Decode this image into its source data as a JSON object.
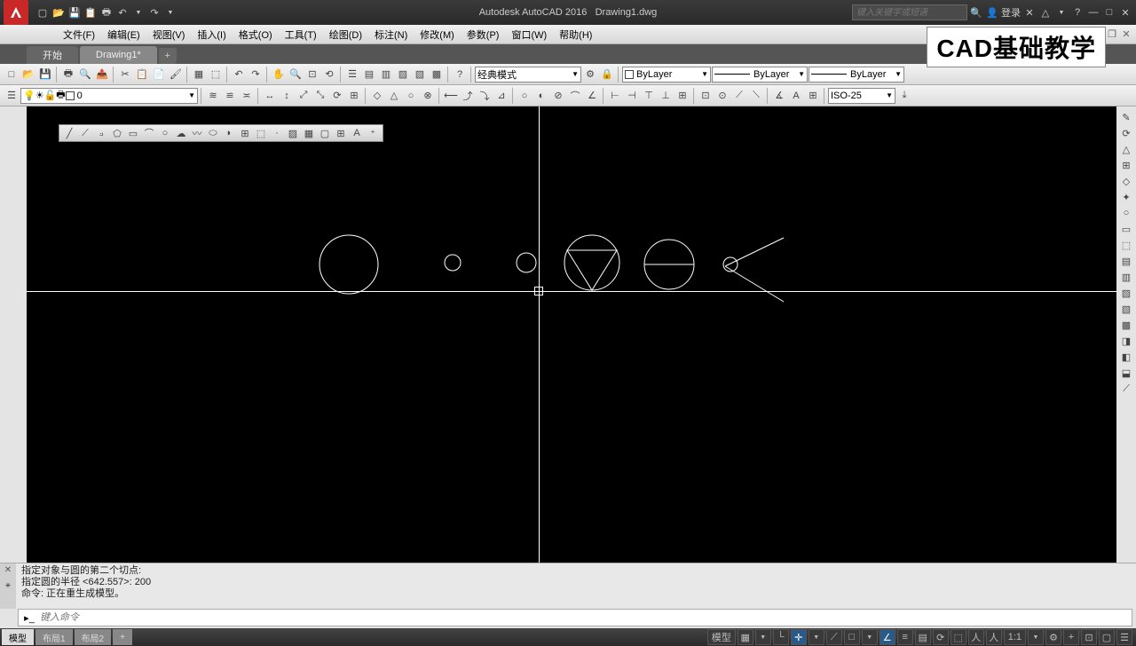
{
  "title": {
    "app": "Autodesk AutoCAD 2016",
    "doc": "Drawing1.dwg"
  },
  "search": {
    "placeholder": "键入关键字或短语",
    "login": "登录"
  },
  "watermark": "CAD基础教学",
  "menus": [
    "文件(F)",
    "编辑(E)",
    "视图(V)",
    "插入(I)",
    "格式(O)",
    "工具(T)",
    "绘图(D)",
    "标注(N)",
    "修改(M)",
    "参数(P)",
    "窗口(W)",
    "帮助(H)"
  ],
  "file_tabs": {
    "start": "开始",
    "draw": "Drawing1*"
  },
  "toolbar1": {
    "workspace": "经典模式"
  },
  "layers": {
    "current": "0",
    "color_label": "ByLayer",
    "linetype": "ByLayer",
    "lineweight": "ByLayer"
  },
  "dimstyle": "ISO-25",
  "cmdline": {
    "l1": "指定对象与圆的第二个切点:",
    "l2": "指定圆的半径 <642.557>: 200",
    "l3": "命令: 正在重生成模型。",
    "prompt": "键入命令"
  },
  "model_tabs": [
    "模型",
    "布局1",
    "布局2"
  ],
  "status": {
    "model": "模型",
    "scale": "1:1"
  }
}
